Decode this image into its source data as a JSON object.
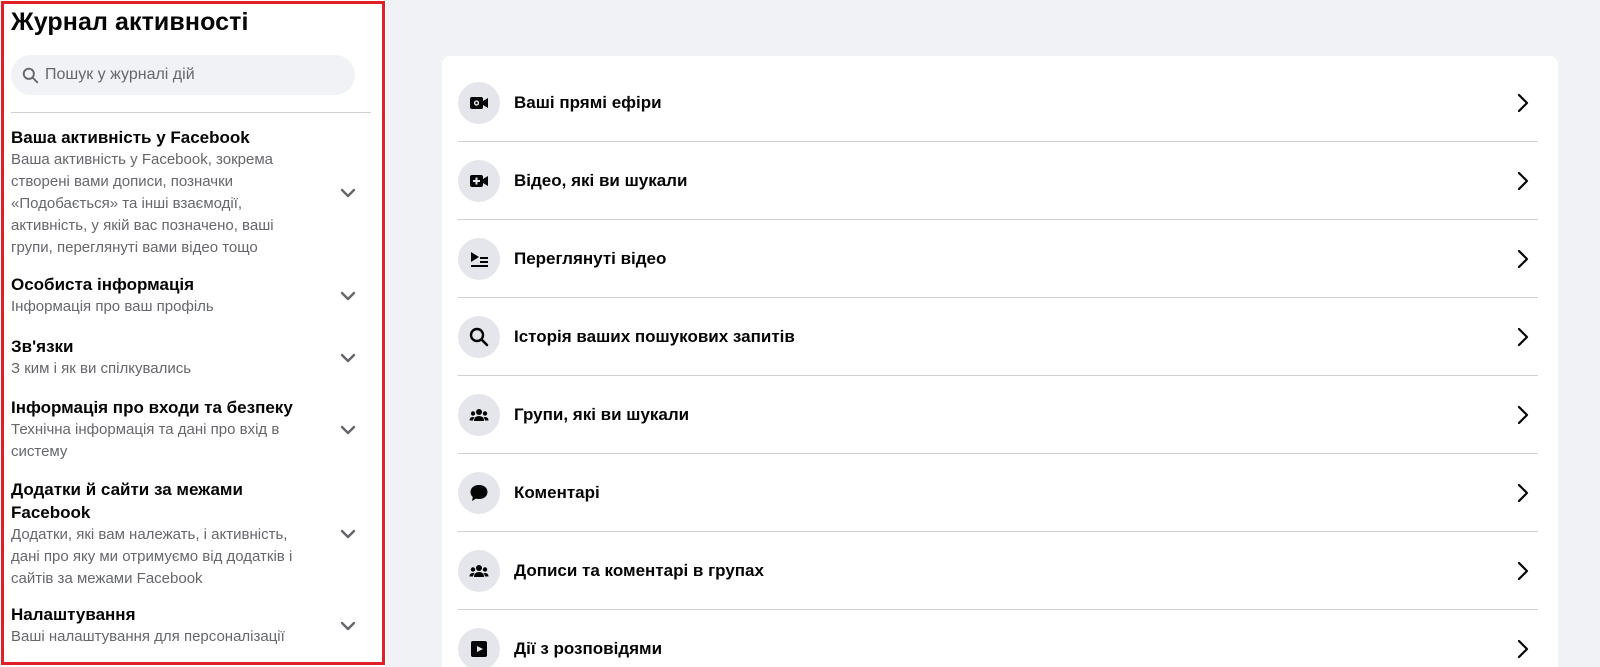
{
  "sidebar": {
    "title": "Журнал активності",
    "search_placeholder": "Пошук у журналі дій",
    "categories": [
      {
        "title": "Ваша активність у Facebook",
        "description": "Ваша активність у Facebook, зокрема створені вами дописи, позначки «Подобається» та інші взаємодії, активність, у якій вас позначено, ваші групи, переглянуті вами відео тощо"
      },
      {
        "title": "Особиста інформація",
        "description": "Інформація про ваш профіль"
      },
      {
        "title": "Зв'язки",
        "description": "З ким і як ви спілкувались"
      },
      {
        "title": "Інформація про входи та безпеку",
        "description": "Технічна інформація та дані про вхід в систему"
      },
      {
        "title": "Додатки й сайти за межами Facebook",
        "description": "Додатки, які вам належать, і активність, дані про яку ми отримуємо від додатків і сайтів за межами Facebook"
      },
      {
        "title": "Налаштування",
        "description": "Ваші налаштування для персоналізації"
      }
    ]
  },
  "main": {
    "items": [
      {
        "label": "Ваші прямі ефіри",
        "icon": "live-video-icon"
      },
      {
        "label": "Відео, які ви шукали",
        "icon": "video-search-icon"
      },
      {
        "label": "Переглянуті відео",
        "icon": "watched-videos-icon"
      },
      {
        "label": "Історія ваших пошукових запитів",
        "icon": "search-icon"
      },
      {
        "label": "Групи, які ви шукали",
        "icon": "groups-icon"
      },
      {
        "label": "Коментарі",
        "icon": "comment-icon"
      },
      {
        "label": "Дописи та коментарі в групах",
        "icon": "groups-icon"
      },
      {
        "label": "Дії з розповідями",
        "icon": "stories-icon"
      }
    ]
  },
  "colors": {
    "highlight_border": "#e02027",
    "page_background": "#f0f2f5",
    "secondary_text": "#65676b"
  }
}
